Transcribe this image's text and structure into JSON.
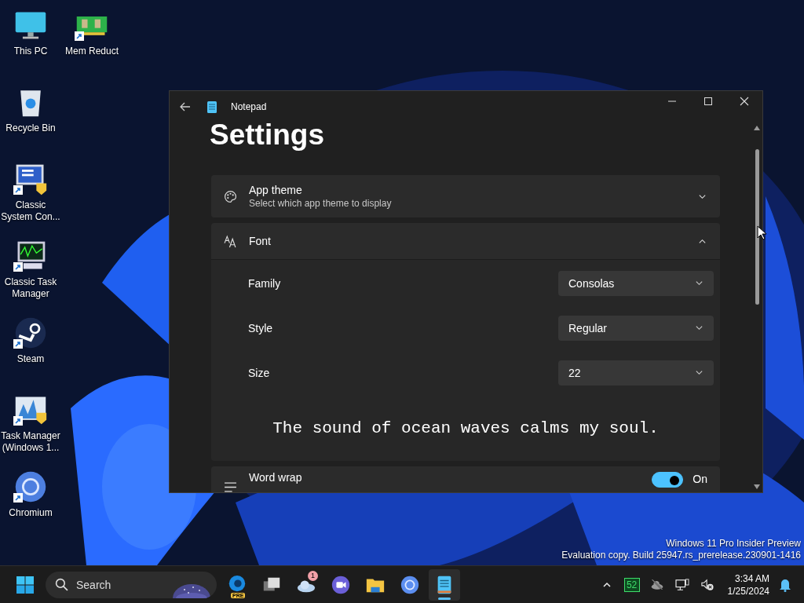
{
  "desktop": {
    "icons": [
      {
        "label": "This PC",
        "shortcut": false
      },
      {
        "label": "Mem Reduct",
        "shortcut": true
      },
      {
        "label": "Recycle Bin",
        "shortcut": false
      },
      {
        "label": "Classic System Con...",
        "shortcut": true
      },
      {
        "label": "Classic Task Manager",
        "shortcut": true
      },
      {
        "label": "Steam",
        "shortcut": true
      },
      {
        "label": "Task Manager (Windows 1...",
        "shortcut": true
      },
      {
        "label": "Chromium",
        "shortcut": true
      }
    ],
    "watermark": [
      "Windows 11 Pro Insider Preview",
      "Evaluation copy. Build 25947.rs_prerelease.230901-1416"
    ]
  },
  "window": {
    "title": "Notepad",
    "heading": "Settings",
    "settings": [
      {
        "kind": "expander",
        "title": "App theme",
        "subtitle": "Select which app theme to display",
        "expanded": false
      },
      {
        "kind": "expander",
        "title": "Font",
        "expanded": true,
        "rows": [
          {
            "label": "Family",
            "value": "Consolas"
          },
          {
            "label": "Style",
            "value": "Regular"
          },
          {
            "label": "Size",
            "value": "22"
          }
        ],
        "preview": "The sound of ocean waves calms my soul."
      },
      {
        "kind": "toggle",
        "title": "Word wrap",
        "on": true,
        "state_label": "On"
      }
    ]
  },
  "taskbar": {
    "search": {
      "placeholder": "Search"
    },
    "apps": [
      {
        "tag": "PRE",
        "selected": false
      },
      {
        "selected": false
      },
      {
        "badge": "1",
        "selected": false
      },
      {
        "selected": false
      },
      {
        "selected": false
      },
      {
        "selected": false
      },
      {
        "selected": true
      }
    ],
    "tray": {
      "temperature": "52",
      "time": "3:34 AM",
      "date": "1/25/2024"
    }
  }
}
